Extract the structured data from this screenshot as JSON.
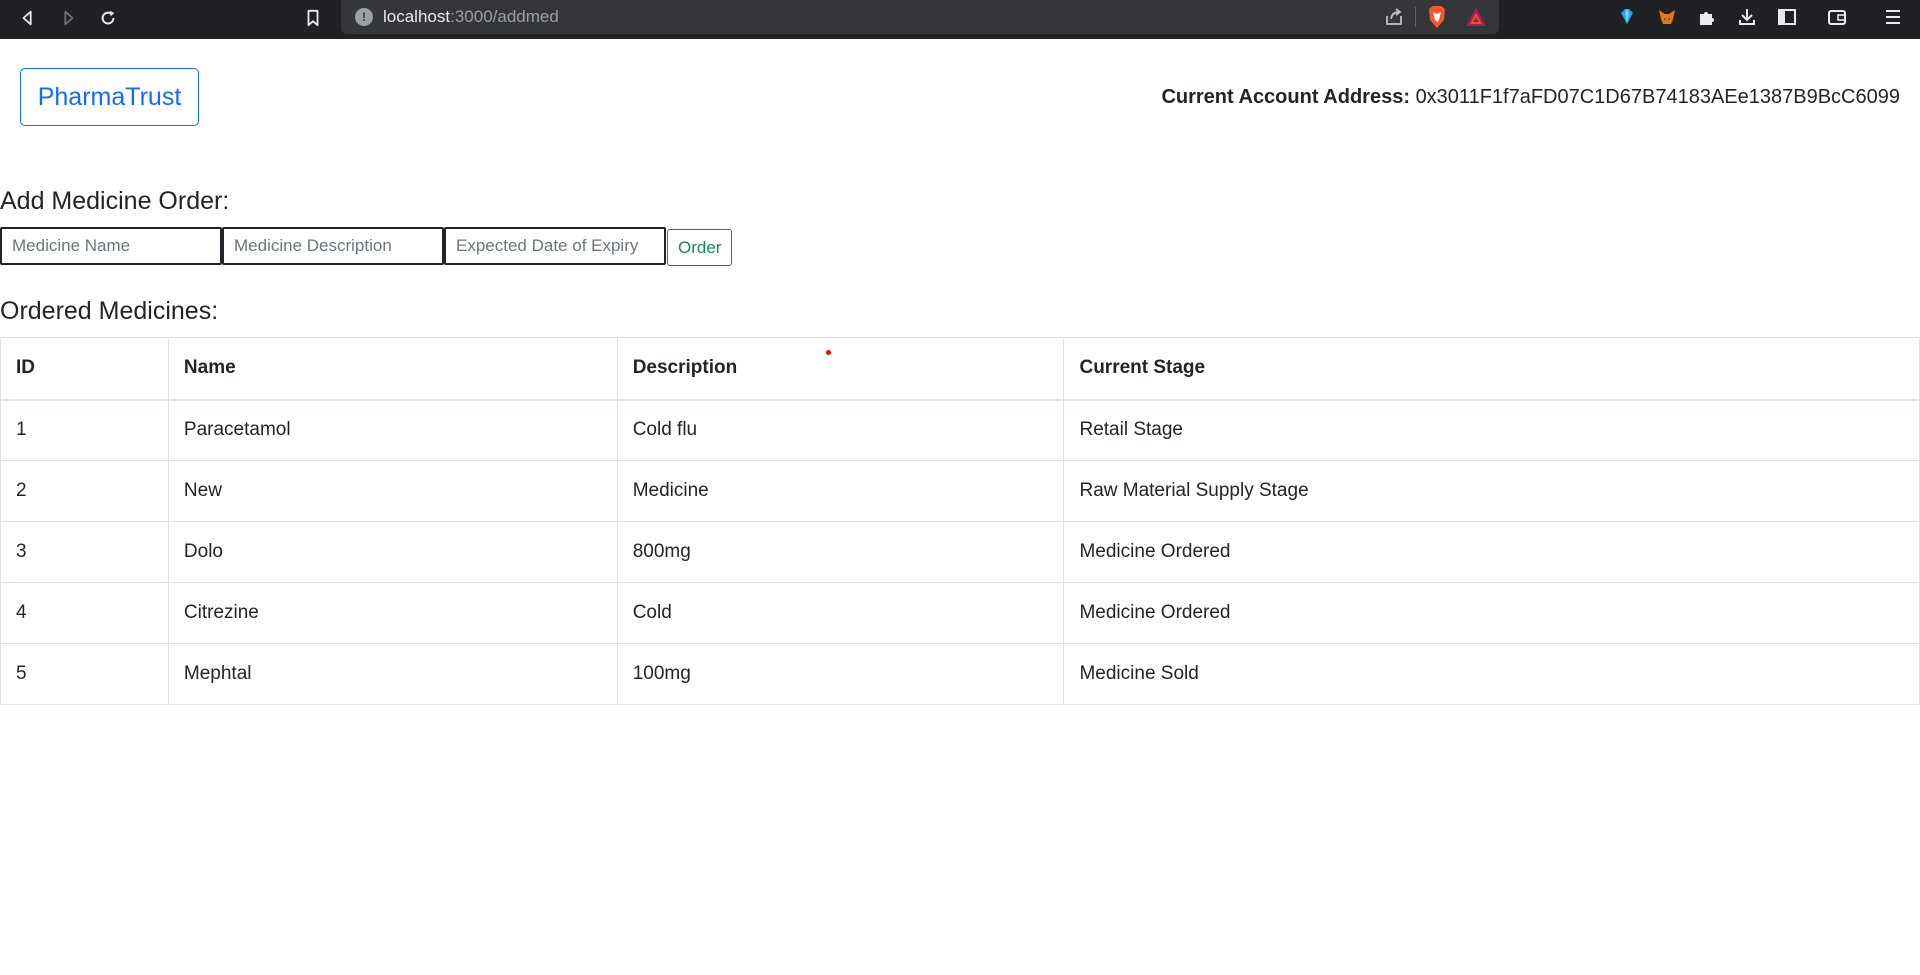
{
  "browser": {
    "url_host": "localhost",
    "url_path": ":3000/addmed",
    "colors": {
      "bar": "#202124",
      "url_box": "#35363a"
    }
  },
  "header": {
    "brand_label": "PharmaTrust",
    "account_label": "Current Account Address:",
    "account_address": "0x3011F1f7aFD07C1D67B74183AEe1387B9BcC6099"
  },
  "add_order": {
    "heading": "Add Medicine Order:",
    "name_placeholder": "Medicine Name",
    "description_placeholder": "Medicine Description",
    "expiry_placeholder": "Expected Date of Expiry",
    "order_label": "Order"
  },
  "ordered": {
    "heading": "Ordered Medicines:",
    "columns": [
      "ID",
      "Name",
      "Description",
      "Current Stage"
    ],
    "rows": [
      [
        "1",
        "Paracetamol",
        "Cold flu",
        "Retail Stage"
      ],
      [
        "2",
        "New",
        "Medicine",
        "Raw Material Supply Stage"
      ],
      [
        "3",
        "Dolo",
        "800mg",
        "Medicine Ordered"
      ],
      [
        "4",
        "Citrezine",
        "Cold",
        "Medicine Ordered"
      ],
      [
        "5",
        "Mephtal",
        "100mg",
        "Medicine Sold"
      ]
    ]
  },
  "colors": {
    "primary": "#0d6efd",
    "success": "#198754",
    "text": "#212529",
    "border": "#dee2e6"
  },
  "icons": [
    "back-icon",
    "forward-icon",
    "reload-icon",
    "bookmark-icon",
    "info-icon",
    "share-icon",
    "brave-shield-icon",
    "bat-rewards-icon",
    "wallet-gem-icon",
    "metamask-fox-icon",
    "extensions-puzzle-icon",
    "download-icon",
    "sidebar-icon",
    "wallet-icon",
    "menu-icon"
  ]
}
